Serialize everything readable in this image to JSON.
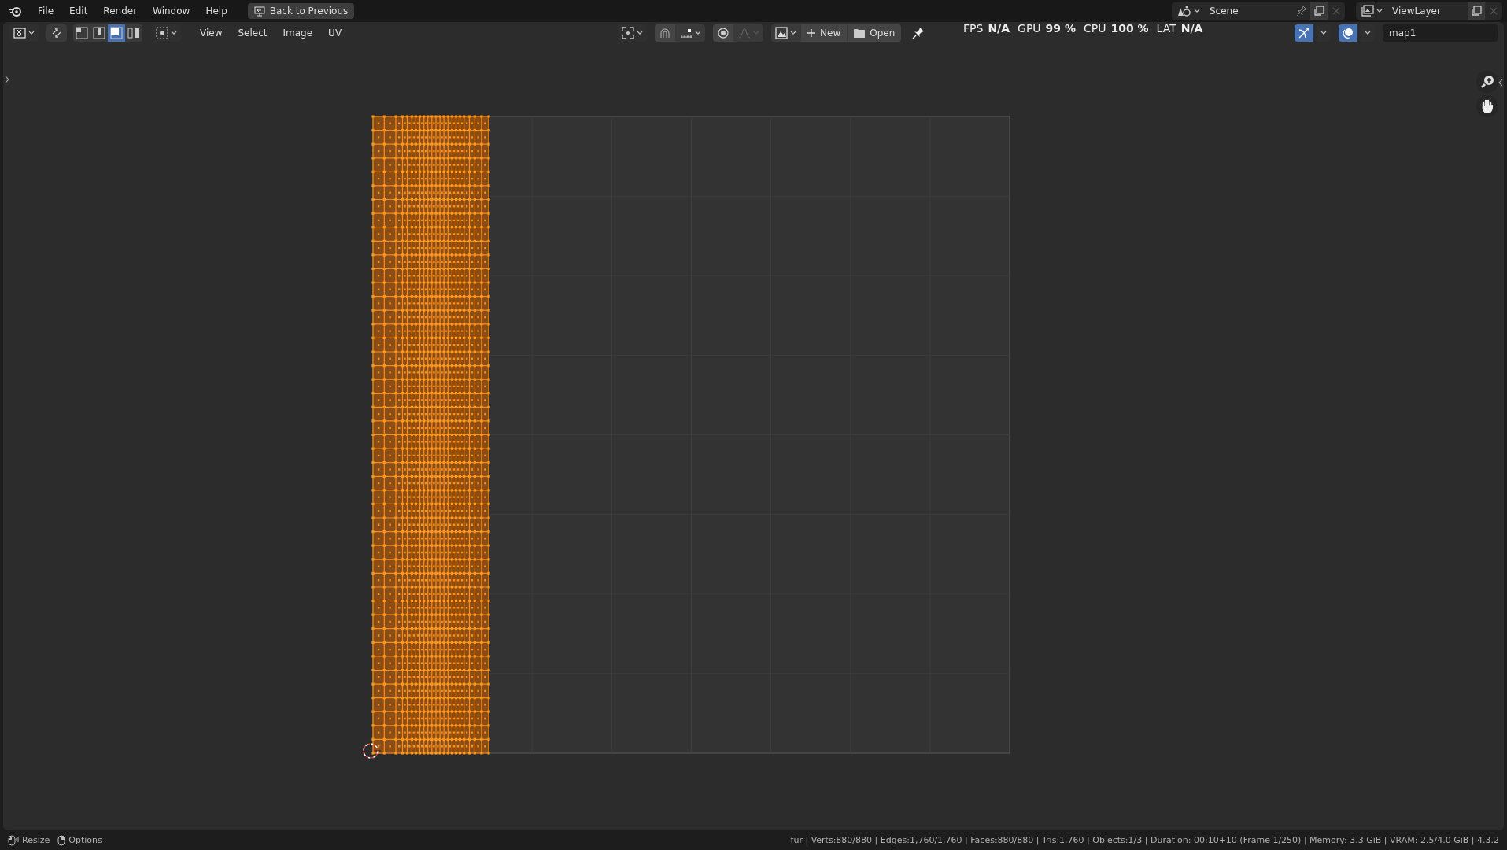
{
  "menu_bar": {
    "menus": [
      "File",
      "Edit",
      "Render",
      "Window",
      "Help"
    ],
    "back_button": "Back to Previous",
    "scene": "Scene",
    "view_layer": "ViewLayer"
  },
  "header": {
    "menus": [
      "View",
      "Select",
      "Image",
      "UV"
    ],
    "select_modes": [
      {
        "kind": "vertex",
        "selected": false
      },
      {
        "kind": "edge",
        "selected": false
      },
      {
        "kind": "face",
        "selected": true
      },
      {
        "kind": "island",
        "selected": false
      }
    ],
    "new_button": "New",
    "open_button": "Open",
    "image_name": "map1"
  },
  "stats": [
    {
      "label": "FPS",
      "value": "N/A"
    },
    {
      "label": "GPU",
      "value": "99 %"
    },
    {
      "label": "CPU",
      "value": "100 %"
    },
    {
      "label": "LAT",
      "value": "N/A"
    }
  ],
  "status_bar": {
    "hints": [
      {
        "kind": "resize",
        "label": "Resize"
      },
      {
        "kind": "options",
        "label": "Options"
      }
    ],
    "info": "fur | Verts:880/880 | Edges:1,760/1,760 | Faces:880/880 | Tris:1,760 | Objects:1/3 | Duration: 00:10+10 (Frame 1/250) | Memory: 3.3 GiB | VRAM: 2.5/4.0 GiB | 4.3.2"
  }
}
